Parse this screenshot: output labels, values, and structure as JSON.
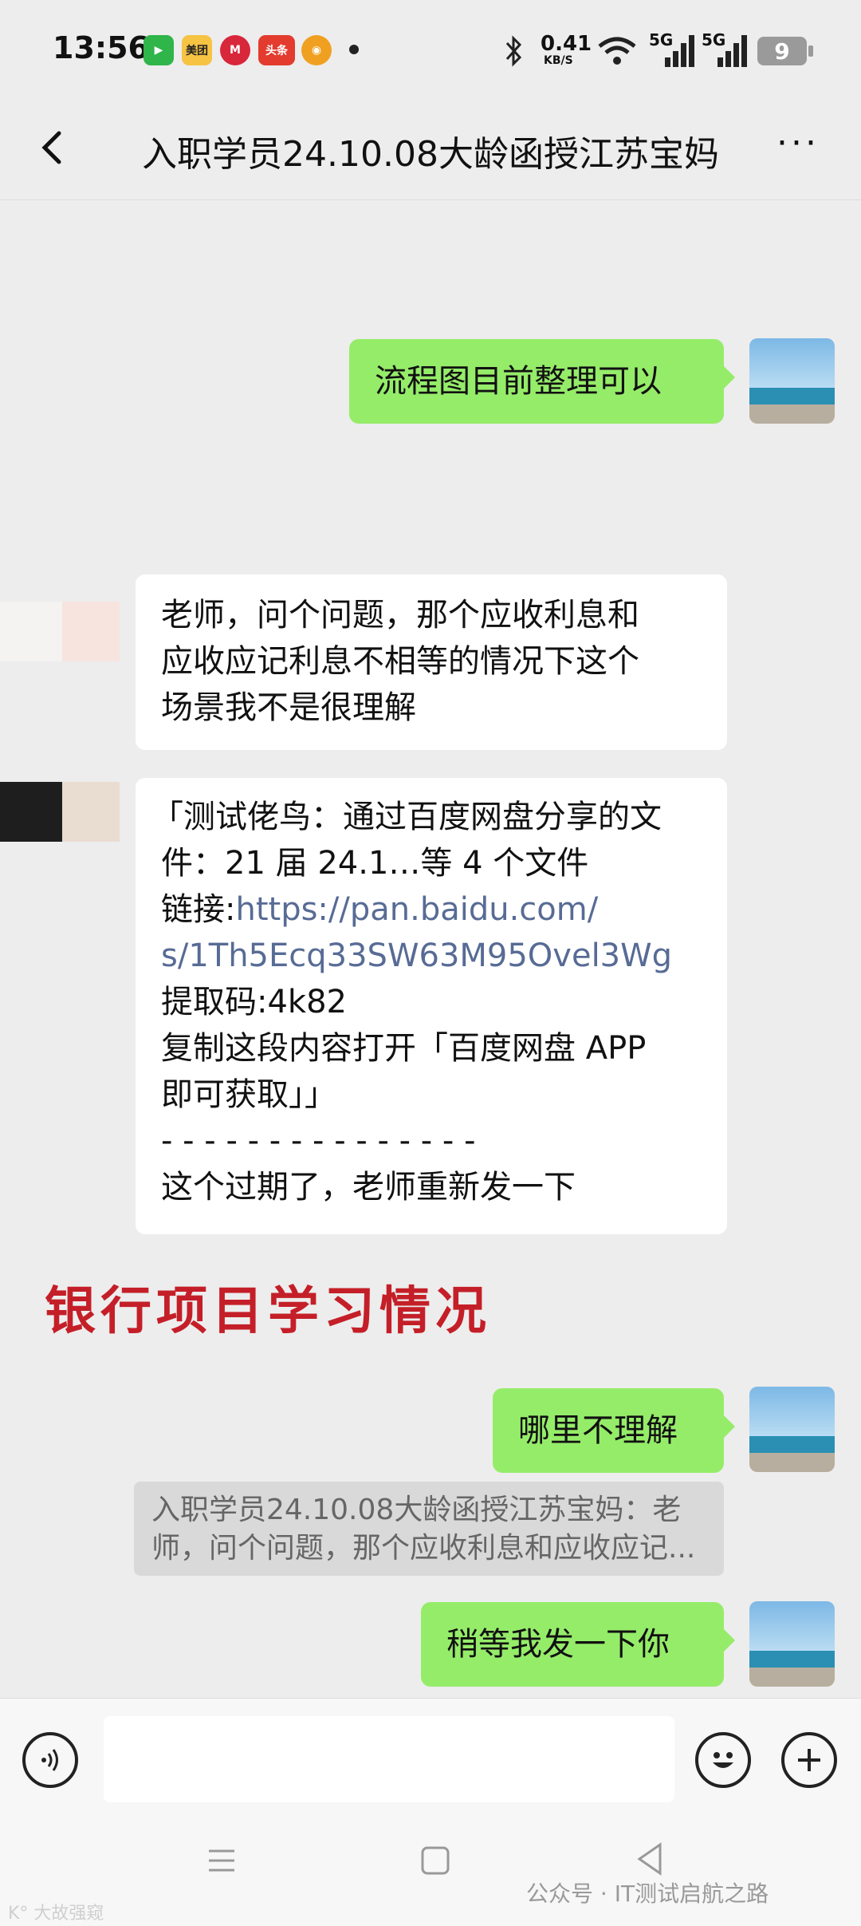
{
  "status_bar": {
    "time": "13:56",
    "apps": [
      {
        "icon": "video-app-icon",
        "label": "",
        "color": "#2fb54a"
      },
      {
        "icon": "meituan-icon",
        "label": "美团",
        "color": "#f6c343"
      },
      {
        "icon": "m-app-icon",
        "label": "M",
        "color": "#d8263a"
      },
      {
        "icon": "toutiao-icon",
        "label": "头条",
        "color": "#e33b2e"
      },
      {
        "icon": "weibo-icon",
        "label": "",
        "color": "#f0a020"
      }
    ],
    "speed": "0.41",
    "speed_unit": "KB/S",
    "net1": "5G",
    "net2": "5G",
    "battery": "9"
  },
  "header": {
    "title": "入职学员24.10.08大龄函授江苏宝妈"
  },
  "messages": {
    "m1": "流程图目前整理可以",
    "m2": [
      "老师，问个问题，那个应收利息和",
      "应收应记利息不相等的情况下这个",
      "场景我不是很理解"
    ],
    "m3": {
      "l1": "「测试佬鸟：通过百度网盘分享的文",
      "l2": "件：21 届 24.1…等 4 个文件",
      "l3_prefix": "链接:",
      "l3_link": "https://pan.baidu.com/",
      "l4_link": "s/1Th5Ecq33SW63M95Ovel3Wg",
      "l5": "提取码:4k82",
      "l6": "复制这段内容打开「百度网盘 APP",
      "l7": "即可获取」」",
      "l8": "- - - - - - - - - - - - - - -",
      "l9": "这个过期了，老师重新发一下"
    },
    "overlay_text": "银行项目学习情况",
    "m4": "哪里不理解",
    "quote": [
      "入职学员24.10.08大龄函授江苏宝妈：老",
      "师，问个问题，那个应收利息和应收应记..."
    ],
    "m5": "稍等我发一下你"
  },
  "nav": {
    "watermark": "公众号 · IT测试启航之路",
    "watermark_left": "K° 大故强窥"
  },
  "colors": {
    "my_bubble": "#95ec69",
    "other_bubble": "#ffffff",
    "link": "#576b95",
    "overlay": "#c41f28"
  }
}
